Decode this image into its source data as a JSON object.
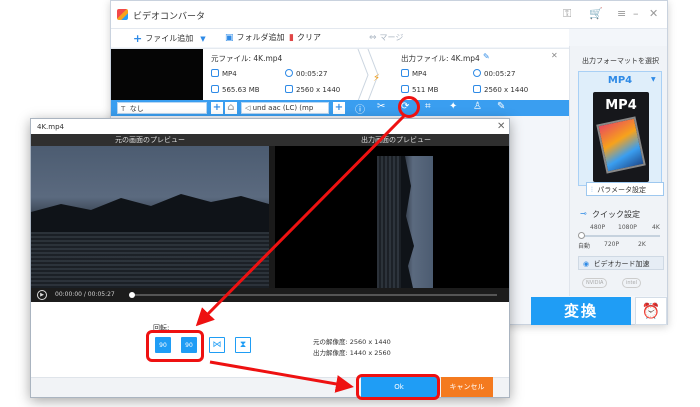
{
  "app": {
    "title": "ビデオコンバータ",
    "toolbar": {
      "add_file": "ファイル追加",
      "add_folder": "フォルダ追加",
      "clear": "クリア",
      "merge": "マージ"
    }
  },
  "file": {
    "source_label": "元ファイル: 4K.mp4",
    "source_format": "MP4",
    "source_duration": "00:05:27",
    "source_size": "565.63 MB",
    "source_resolution": "2560 x 1440",
    "output_label": "出力ファイル: 4K.mp4",
    "output_format": "MP4",
    "output_duration": "00:05:27",
    "output_size": "511 MB",
    "output_resolution": "2560 x 1440"
  },
  "edit_bar": {
    "subtitle": "なし",
    "audio": "und aac (LC) (mp"
  },
  "right_panel": {
    "select_format": "出力フォーマットを選択",
    "format": "MP4",
    "card_text": "MP4",
    "parameters": "パラメータ設定",
    "quick_setting": "クイック設定",
    "ticks_top": [
      "480P",
      "1080P",
      "4K"
    ],
    "ticks_bottom": [
      "自動",
      "720P",
      "2K"
    ],
    "gpu": "ビデオカード加速",
    "gpu_brands": [
      "NVIDIA",
      "intel"
    ]
  },
  "actions": {
    "convert": "変換"
  },
  "dialog": {
    "title": "4K.mp4",
    "original_preview": "元の画面のプレビュー",
    "output_preview": "出力画面のプレビュー",
    "time": "00:00:00 / 00:05:27",
    "rotate_label": "回転:",
    "rotate_left_label": "90",
    "rotate_right_label": "90",
    "original_resolution": "元の解像度: 2560 x 1440",
    "output_resolution": "出力解像度: 1440 x 2560",
    "ok": "Ok",
    "cancel": "キャンセル"
  },
  "colors": {
    "accent": "#1f9df5",
    "cancel": "#f47a1f",
    "annotation": "#e11"
  }
}
